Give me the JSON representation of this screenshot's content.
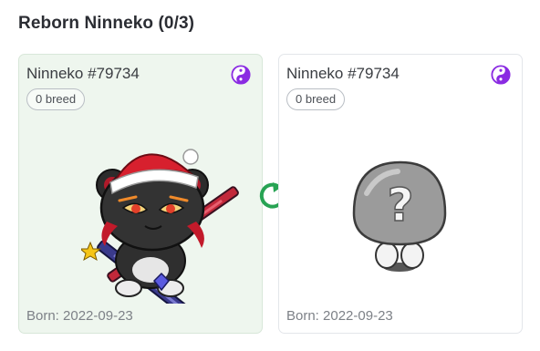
{
  "section": {
    "title": "Reborn Ninneko (0/3)"
  },
  "cards": [
    {
      "name": "Ninneko #79734",
      "breed_label": "0 breed",
      "born_label": "Born: 2022-09-23",
      "class_icon": "yin-yang-icon",
      "image": "ninneko-character-with-santa-hat-and-sword",
      "selected": true
    },
    {
      "name": "Ninneko #79734",
      "breed_label": "0 breed",
      "born_label": "Born: 2022-09-23",
      "class_icon": "yin-yang-icon",
      "image": "mystery-egg-question-mark",
      "selected": false
    }
  ],
  "swap_icon": "swap-arrows-icon",
  "colors": {
    "accent_purple": "#8a2be2",
    "swap_green": "#27a353",
    "selected_card_bg": "#eef6ee"
  }
}
